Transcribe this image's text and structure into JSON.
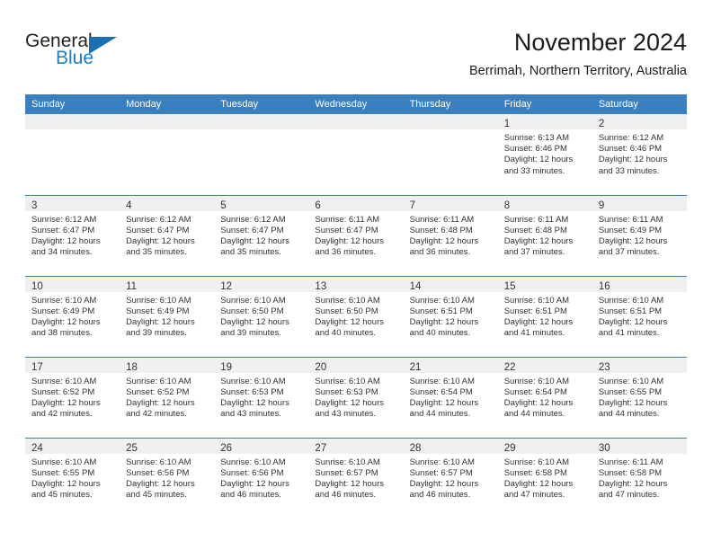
{
  "brand": {
    "name_dark": "General",
    "name_blue": "Blue",
    "logo_icon": "triangle-flag-icon",
    "accent_color": "#1a6fb5"
  },
  "header": {
    "title": "November 2024",
    "subtitle": "Berrimah, Northern Territory, Australia"
  },
  "calendar": {
    "header_bg_color": "#3a7fc0",
    "daynum_band_color": "#f0f0f0",
    "weekdays": [
      "Sunday",
      "Monday",
      "Tuesday",
      "Wednesday",
      "Thursday",
      "Friday",
      "Saturday"
    ],
    "weeks": [
      [
        {
          "day": "",
          "empty": true
        },
        {
          "day": "",
          "empty": true
        },
        {
          "day": "",
          "empty": true
        },
        {
          "day": "",
          "empty": true
        },
        {
          "day": "",
          "empty": true
        },
        {
          "day": "1",
          "sunrise": "Sunrise: 6:13 AM",
          "sunset": "Sunset: 6:46 PM",
          "daylight1": "Daylight: 12 hours",
          "daylight2": "and 33 minutes."
        },
        {
          "day": "2",
          "sunrise": "Sunrise: 6:12 AM",
          "sunset": "Sunset: 6:46 PM",
          "daylight1": "Daylight: 12 hours",
          "daylight2": "and 33 minutes."
        }
      ],
      [
        {
          "day": "3",
          "sunrise": "Sunrise: 6:12 AM",
          "sunset": "Sunset: 6:47 PM",
          "daylight1": "Daylight: 12 hours",
          "daylight2": "and 34 minutes."
        },
        {
          "day": "4",
          "sunrise": "Sunrise: 6:12 AM",
          "sunset": "Sunset: 6:47 PM",
          "daylight1": "Daylight: 12 hours",
          "daylight2": "and 35 minutes."
        },
        {
          "day": "5",
          "sunrise": "Sunrise: 6:12 AM",
          "sunset": "Sunset: 6:47 PM",
          "daylight1": "Daylight: 12 hours",
          "daylight2": "and 35 minutes."
        },
        {
          "day": "6",
          "sunrise": "Sunrise: 6:11 AM",
          "sunset": "Sunset: 6:47 PM",
          "daylight1": "Daylight: 12 hours",
          "daylight2": "and 36 minutes."
        },
        {
          "day": "7",
          "sunrise": "Sunrise: 6:11 AM",
          "sunset": "Sunset: 6:48 PM",
          "daylight1": "Daylight: 12 hours",
          "daylight2": "and 36 minutes."
        },
        {
          "day": "8",
          "sunrise": "Sunrise: 6:11 AM",
          "sunset": "Sunset: 6:48 PM",
          "daylight1": "Daylight: 12 hours",
          "daylight2": "and 37 minutes."
        },
        {
          "day": "9",
          "sunrise": "Sunrise: 6:11 AM",
          "sunset": "Sunset: 6:49 PM",
          "daylight1": "Daylight: 12 hours",
          "daylight2": "and 37 minutes."
        }
      ],
      [
        {
          "day": "10",
          "sunrise": "Sunrise: 6:10 AM",
          "sunset": "Sunset: 6:49 PM",
          "daylight1": "Daylight: 12 hours",
          "daylight2": "and 38 minutes."
        },
        {
          "day": "11",
          "sunrise": "Sunrise: 6:10 AM",
          "sunset": "Sunset: 6:49 PM",
          "daylight1": "Daylight: 12 hours",
          "daylight2": "and 39 minutes."
        },
        {
          "day": "12",
          "sunrise": "Sunrise: 6:10 AM",
          "sunset": "Sunset: 6:50 PM",
          "daylight1": "Daylight: 12 hours",
          "daylight2": "and 39 minutes."
        },
        {
          "day": "13",
          "sunrise": "Sunrise: 6:10 AM",
          "sunset": "Sunset: 6:50 PM",
          "daylight1": "Daylight: 12 hours",
          "daylight2": "and 40 minutes."
        },
        {
          "day": "14",
          "sunrise": "Sunrise: 6:10 AM",
          "sunset": "Sunset: 6:51 PM",
          "daylight1": "Daylight: 12 hours",
          "daylight2": "and 40 minutes."
        },
        {
          "day": "15",
          "sunrise": "Sunrise: 6:10 AM",
          "sunset": "Sunset: 6:51 PM",
          "daylight1": "Daylight: 12 hours",
          "daylight2": "and 41 minutes."
        },
        {
          "day": "16",
          "sunrise": "Sunrise: 6:10 AM",
          "sunset": "Sunset: 6:51 PM",
          "daylight1": "Daylight: 12 hours",
          "daylight2": "and 41 minutes."
        }
      ],
      [
        {
          "day": "17",
          "sunrise": "Sunrise: 6:10 AM",
          "sunset": "Sunset: 6:52 PM",
          "daylight1": "Daylight: 12 hours",
          "daylight2": "and 42 minutes."
        },
        {
          "day": "18",
          "sunrise": "Sunrise: 6:10 AM",
          "sunset": "Sunset: 6:52 PM",
          "daylight1": "Daylight: 12 hours",
          "daylight2": "and 42 minutes."
        },
        {
          "day": "19",
          "sunrise": "Sunrise: 6:10 AM",
          "sunset": "Sunset: 6:53 PM",
          "daylight1": "Daylight: 12 hours",
          "daylight2": "and 43 minutes."
        },
        {
          "day": "20",
          "sunrise": "Sunrise: 6:10 AM",
          "sunset": "Sunset: 6:53 PM",
          "daylight1": "Daylight: 12 hours",
          "daylight2": "and 43 minutes."
        },
        {
          "day": "21",
          "sunrise": "Sunrise: 6:10 AM",
          "sunset": "Sunset: 6:54 PM",
          "daylight1": "Daylight: 12 hours",
          "daylight2": "and 44 minutes."
        },
        {
          "day": "22",
          "sunrise": "Sunrise: 6:10 AM",
          "sunset": "Sunset: 6:54 PM",
          "daylight1": "Daylight: 12 hours",
          "daylight2": "and 44 minutes."
        },
        {
          "day": "23",
          "sunrise": "Sunrise: 6:10 AM",
          "sunset": "Sunset: 6:55 PM",
          "daylight1": "Daylight: 12 hours",
          "daylight2": "and 44 minutes."
        }
      ],
      [
        {
          "day": "24",
          "sunrise": "Sunrise: 6:10 AM",
          "sunset": "Sunset: 6:55 PM",
          "daylight1": "Daylight: 12 hours",
          "daylight2": "and 45 minutes."
        },
        {
          "day": "25",
          "sunrise": "Sunrise: 6:10 AM",
          "sunset": "Sunset: 6:56 PM",
          "daylight1": "Daylight: 12 hours",
          "daylight2": "and 45 minutes."
        },
        {
          "day": "26",
          "sunrise": "Sunrise: 6:10 AM",
          "sunset": "Sunset: 6:56 PM",
          "daylight1": "Daylight: 12 hours",
          "daylight2": "and 46 minutes."
        },
        {
          "day": "27",
          "sunrise": "Sunrise: 6:10 AM",
          "sunset": "Sunset: 6:57 PM",
          "daylight1": "Daylight: 12 hours",
          "daylight2": "and 46 minutes."
        },
        {
          "day": "28",
          "sunrise": "Sunrise: 6:10 AM",
          "sunset": "Sunset: 6:57 PM",
          "daylight1": "Daylight: 12 hours",
          "daylight2": "and 46 minutes."
        },
        {
          "day": "29",
          "sunrise": "Sunrise: 6:10 AM",
          "sunset": "Sunset: 6:58 PM",
          "daylight1": "Daylight: 12 hours",
          "daylight2": "and 47 minutes."
        },
        {
          "day": "30",
          "sunrise": "Sunrise: 6:11 AM",
          "sunset": "Sunset: 6:58 PM",
          "daylight1": "Daylight: 12 hours",
          "daylight2": "and 47 minutes."
        }
      ]
    ]
  }
}
